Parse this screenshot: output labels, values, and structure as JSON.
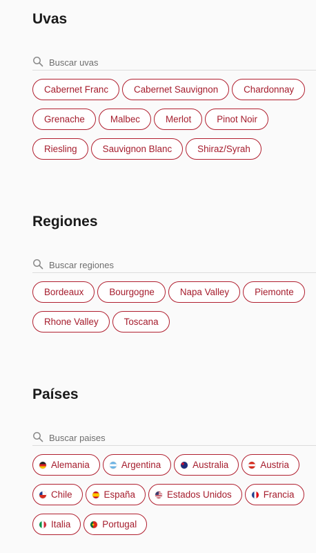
{
  "sections": {
    "uvas": {
      "title": "Uvas",
      "search_placeholder": "Buscar uvas",
      "chips": [
        "Cabernet Franc",
        "Cabernet Sauvignon",
        "Chardonnay",
        "Grenache",
        "Malbec",
        "Merlot",
        "Pinot Noir",
        "Riesling",
        "Sauvignon Blanc",
        "Shiraz/Syrah"
      ]
    },
    "regiones": {
      "title": "Regiones",
      "search_placeholder": "Buscar regiones",
      "chips": [
        "Bordeaux",
        "Bourgogne",
        "Napa Valley",
        "Piemonte",
        "Rhone Valley",
        "Toscana"
      ]
    },
    "paises": {
      "title": "Países",
      "search_placeholder": "Buscar paises",
      "chips": [
        {
          "label": "Alemania",
          "flag": "germany-flag"
        },
        {
          "label": "Argentina",
          "flag": "argentina-flag"
        },
        {
          "label": "Australia",
          "flag": "australia-flag"
        },
        {
          "label": "Austria",
          "flag": "austria-flag"
        },
        {
          "label": "Chile",
          "flag": "chile-flag"
        },
        {
          "label": "España",
          "flag": "spain-flag"
        },
        {
          "label": "Estados Unidos",
          "flag": "usa-flag"
        },
        {
          "label": "Francia",
          "flag": "france-flag"
        },
        {
          "label": "Italia",
          "flag": "italy-flag"
        },
        {
          "label": "Portugal",
          "flag": "portugal-flag"
        }
      ]
    }
  },
  "colors": {
    "accent": "#a51c2c",
    "chip_border": "#b01e2e",
    "background": "#fafafa"
  },
  "icons": {
    "search": "search-icon"
  }
}
